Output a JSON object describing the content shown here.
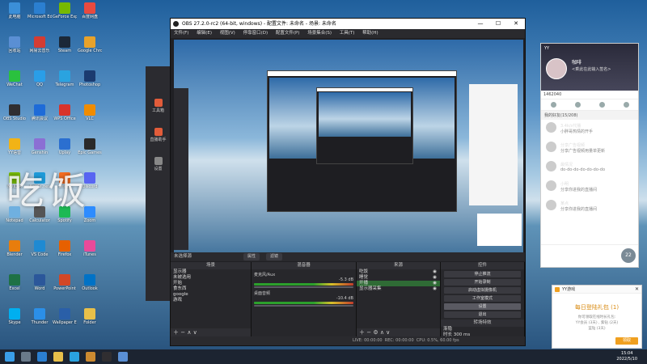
{
  "desktop": {
    "icons": [
      {
        "label": "此电脑",
        "color": "#3b8fd8"
      },
      {
        "label": "Microsoft Edge",
        "color": "#2b7fd0"
      },
      {
        "label": "GeForce Experience",
        "color": "#76b900"
      },
      {
        "label": "百度网盘",
        "color": "#e84a3f"
      },
      {
        "label": "回收站",
        "color": "#5a8fd4"
      },
      {
        "label": "网易云音乐",
        "color": "#d43c33"
      },
      {
        "label": "Steam",
        "color": "#1b2838"
      },
      {
        "label": "Google Chrome",
        "color": "#e8a22b"
      },
      {
        "label": "WeChat",
        "color": "#2ac13e"
      },
      {
        "label": "QQ",
        "color": "#2a9ee8"
      },
      {
        "label": "Telegram",
        "color": "#2aa3e0"
      },
      {
        "label": "Photoshop",
        "color": "#1b3b70"
      },
      {
        "label": "OBS Studio",
        "color": "#302e31"
      },
      {
        "label": "腾讯会议",
        "color": "#1e6bd8"
      },
      {
        "label": "WPS Office",
        "color": "#d8332b"
      },
      {
        "label": "VLC",
        "color": "#f08c00"
      },
      {
        "label": "YY语音",
        "color": "#f2b316"
      },
      {
        "label": "Genshin",
        "color": "#8b6fd4"
      },
      {
        "label": "Uplay",
        "color": "#2b6fd0"
      },
      {
        "label": "Epic Games",
        "color": "#2a2a2a"
      },
      {
        "label": "NVIDIA",
        "color": "#76b900"
      },
      {
        "label": "Battle.net",
        "color": "#1e9ad8"
      },
      {
        "label": "Origin",
        "color": "#f36c21"
      },
      {
        "label": "Discord",
        "color": "#5865f2"
      },
      {
        "label": "Notepad",
        "color": "#6fb0e0"
      },
      {
        "label": "Calculator",
        "color": "#555"
      },
      {
        "label": "Spotify",
        "color": "#1db954"
      },
      {
        "label": "Zoom",
        "color": "#2d8cff"
      },
      {
        "label": "Blender",
        "color": "#e87d0d"
      },
      {
        "label": "VS Code",
        "color": "#1f8ad2"
      },
      {
        "label": "Firefox",
        "color": "#e66000"
      },
      {
        "label": "iTunes",
        "color": "#e84a9a"
      },
      {
        "label": "Excel",
        "color": "#1e7145"
      },
      {
        "label": "Word",
        "color": "#2b579a"
      },
      {
        "label": "PowerPoint",
        "color": "#d24726"
      },
      {
        "label": "Outlook",
        "color": "#0072c6"
      },
      {
        "label": "Skype",
        "color": "#00aff0"
      },
      {
        "label": "Thunder",
        "color": "#2b8fe8"
      },
      {
        "label": "Wallpaper Engine",
        "color": "#2a5fa8"
      },
      {
        "label": "Folder",
        "color": "#e8c04a"
      }
    ],
    "watermark": "吃饭"
  },
  "bg_app": {
    "tabs": [
      "工具箱",
      "直播助手",
      "设置"
    ]
  },
  "obs": {
    "title": "OBS 27.2.0-rc2 (64-bit, windows) - 配置文件: 未命名 - 场景: 未命名",
    "menu": [
      "文件(F)",
      "编辑(E)",
      "视图(V)",
      "停靠窗口(D)",
      "配置文件(P)",
      "场景集合(S)",
      "工具(T)",
      "帮助(H)"
    ],
    "window_controls": {
      "minimize": "—",
      "maximize": "☐",
      "close": "✕"
    },
    "scene_bar": {
      "label": "未选择源",
      "btn_properties": "属性",
      "btn_filters": "滤镜"
    },
    "docks": {
      "scenes": {
        "title": "场景",
        "items": [
          "显示器",
          "未被选用",
          "开始",
          "食东西",
          "google",
          "游戏"
        ]
      },
      "mixer": {
        "title": "混音器",
        "channels": [
          {
            "name": "麦克风/Aux",
            "db": "-5.3 dB"
          },
          {
            "name": "桌面音频",
            "db": "-10.4 dB"
          }
        ]
      },
      "sources": {
        "title": "来源",
        "items": [
          "吃饭",
          "睡觉",
          "开播",
          "显示器采集"
        ]
      },
      "controls": {
        "title": "控件",
        "buttons": [
          "停止推流",
          "开始录制",
          "启动虚拟摄像机",
          "工作室模式",
          "设置",
          "退出"
        ]
      },
      "transition": {
        "title": "转场特效",
        "type": "渐隐",
        "duration_label": "时长",
        "duration": "300 ms"
      }
    },
    "statusbar": {
      "live": "LIVE: 00:00:00",
      "rec": "REC: 00:00:00",
      "cpu": "CPU: 0.5%, 60.00 fps"
    }
  },
  "yy": {
    "title": "YY",
    "name": "咖啡",
    "status": "<乘此在此输入签名>",
    "search_value": "1462040",
    "group": "我的好友(15/208)",
    "messages": [
      {
        "text": "3.4k/s代播",
        "sub": "小胖哥热情的开手"
      },
      {
        "text": "分享广告视频",
        "sub": "分享广告视频用量单更新"
      },
      {
        "text": "最情况",
        "sub": "do-do-do-do-do-do-do"
      },
      {
        "text": "小明",
        "sub": "分享你进我的直播间"
      },
      {
        "text": "某点",
        "sub": "分享你进我的直播间"
      }
    ],
    "badge": "22"
  },
  "popup": {
    "app": "YY游戏",
    "title": "每日登陆礼包 (1)",
    "desc1": "你可领取在线时长礼包:",
    "desc2": "YY会员 (3天) , 紫钻 (2天)",
    "desc3": "蓝钻 (3天)",
    "button": "领取"
  },
  "taskbar": {
    "time": "15:04",
    "date": "2022/5/10",
    "apps": [
      "start",
      "search",
      "edge",
      "explorer",
      "telegram",
      "obs",
      "yy"
    ]
  }
}
